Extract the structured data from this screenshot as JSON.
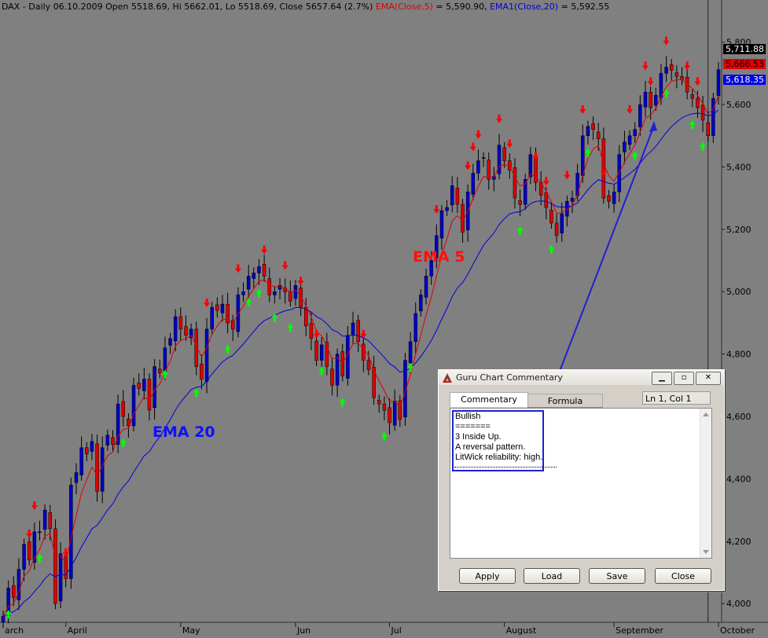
{
  "header": {
    "prefix": "DAX  - Daily 06.10.2009 Open 5518.69, Hi 5662.01, Lo 5518.69, Close 5657.64 (2.7%)",
    "ema5": "EMA(Close,5)",
    "ema5_value": " = 5,590.90, ",
    "ema20": "EMA1(Close,20)",
    "ema20_value": " = 5,592.55"
  },
  "annotations": {
    "ema5": "EMA 5",
    "ema20": "EMA 20"
  },
  "price_labels": {
    "close": "5,711.88",
    "ema5": "5,666.53",
    "ema20": "5,618.35"
  },
  "colors": {
    "background": "#808080",
    "up": "#0000c8",
    "down": "#e00000",
    "ema5": "#e00000",
    "ema20": "#0000e0",
    "bull_arrow": "#00ff00",
    "bear_arrow": "#ff0000"
  },
  "window": {
    "title": "Guru Chart Commentary",
    "controls": [
      "minimize-icon",
      "maximize-icon",
      "close-icon"
    ],
    "tabs": [
      "Commentary",
      "Formula"
    ],
    "status": "Ln 1, Col 1",
    "commentary_lines": [
      "Bullish",
      "=======",
      "3 Inside Up.",
      "A reversal pattern.",
      "LitWick reliability: high."
    ],
    "buttons": {
      "apply": "Apply",
      "load": "Load",
      "save": "Save",
      "close": "Close"
    }
  },
  "chart_data": {
    "type": "candlestick",
    "instrument": "DAX",
    "months": [
      "arch",
      "April",
      "May",
      "Jun",
      "Jul",
      "August",
      "September",
      "October"
    ],
    "y_ticks": [
      4000,
      4200,
      4400,
      4600,
      4800,
      5000,
      5200,
      5400,
      5600,
      5800
    ],
    "y_tick_labels": [
      "4,000",
      "4,200",
      "4,400",
      "4,600",
      "4,800",
      "5,000",
      "5,200",
      "5,400",
      "5,600",
      "5,800"
    ],
    "ylim": [
      3940,
      5900
    ],
    "closes": [
      3960,
      4050,
      4020,
      4110,
      4190,
      4140,
      4230,
      4230,
      4300,
      4240,
      4000,
      4160,
      4080,
      4380,
      4420,
      4500,
      4480,
      4520,
      4360,
      4500,
      4540,
      4510,
      4640,
      4600,
      4570,
      4700,
      4690,
      4720,
      4620,
      4760,
      4740,
      4820,
      4850,
      4920,
      4880,
      4860,
      4880,
      4760,
      4720,
      4880,
      4950,
      4940,
      4960,
      4900,
      4880,
      4990,
      5000,
      5050,
      5060,
      5080,
      5050,
      4990,
      5000,
      5020,
      5000,
      4970,
      5020,
      4950,
      4890,
      4850,
      4780,
      4830,
      4760,
      4700,
      4800,
      4730,
      4860,
      4900,
      4840,
      4780,
      4750,
      4660,
      4640,
      4620,
      4580,
      4650,
      4590,
      4780,
      4840,
      4930,
      4990,
      5050,
      5100,
      5180,
      5260,
      5270,
      5340,
      5280,
      5190,
      5320,
      5380,
      5420,
      5430,
      5360,
      5370,
      5470,
      5420,
      5390,
      5300,
      5280,
      5360,
      5440,
      5350,
      5310,
      5270,
      5220,
      5180,
      5250,
      5290,
      5300,
      5380,
      5500,
      5530,
      5520,
      5490,
      5300,
      5290,
      5320,
      5440,
      5480,
      5500,
      5520,
      5600,
      5640,
      5590,
      5630,
      5700,
      5720,
      5710,
      5690,
      5680,
      5640,
      5620,
      5590,
      5550,
      5500,
      5620,
      5712
    ],
    "ema5_last": 5590.9,
    "ema20_last": 5592.55,
    "last_close": 5657.64,
    "bull_arrow_days": [
      1,
      7,
      24,
      32,
      38,
      44,
      48,
      50,
      53,
      56,
      62,
      66,
      75,
      80,
      101,
      107,
      114,
      124,
      130,
      135,
      137
    ],
    "bear_arrow_days": [
      5,
      6,
      12,
      40,
      46,
      51,
      55,
      58,
      61,
      70,
      85,
      91,
      92,
      93,
      97,
      99,
      104,
      106,
      110,
      113,
      118,
      123,
      126,
      127,
      130,
      134,
      136
    ]
  }
}
